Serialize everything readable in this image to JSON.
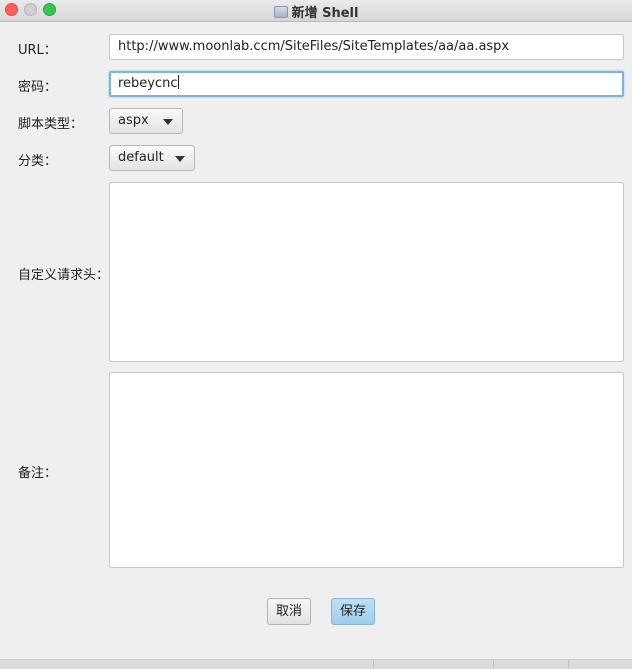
{
  "window": {
    "title": "新增 Shell"
  },
  "form": {
    "url": {
      "label": "URL：",
      "value": "http://www.moonlab.ccm/SiteFiles/SiteTemplates/aa/aa.aspx"
    },
    "password": {
      "label": "密码：",
      "value": "rebeycnc"
    },
    "script_type": {
      "label": "脚本类型：",
      "selected": "aspx"
    },
    "category": {
      "label": "分类：",
      "selected": "default"
    },
    "headers": {
      "label": "自定义请求头：",
      "value": ""
    },
    "notes": {
      "label": "备注：",
      "value": ""
    }
  },
  "buttons": {
    "cancel": "取消",
    "save": "保存"
  },
  "colors": {
    "save_button": "#a9d3ec",
    "focus_ring": "#7fb2dc"
  }
}
